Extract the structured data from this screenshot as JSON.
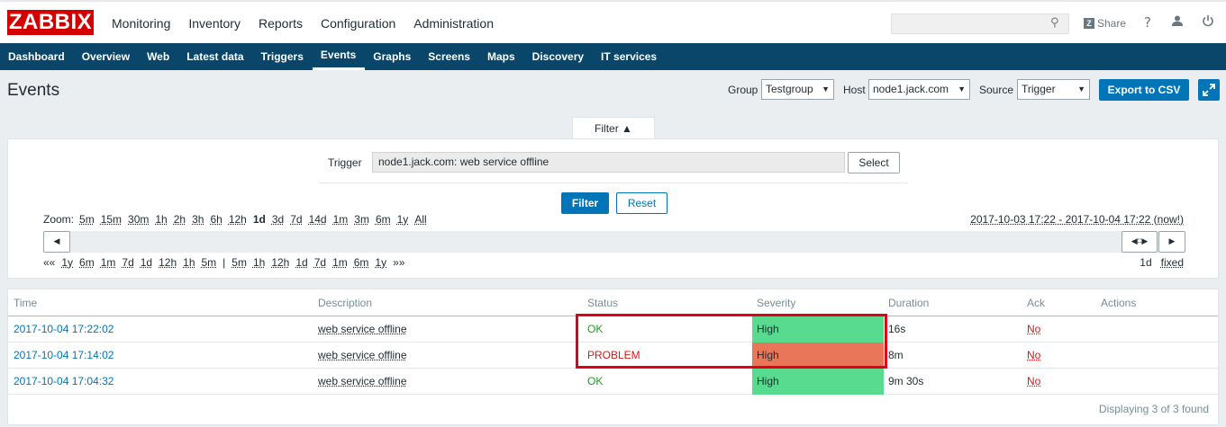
{
  "header": {
    "logo": "ZABBIX",
    "menu": [
      "Monitoring",
      "Inventory",
      "Reports",
      "Configuration",
      "Administration"
    ],
    "search_placeholder": "",
    "share_label": "Share",
    "help_icon": "?"
  },
  "subnav": [
    "Dashboard",
    "Overview",
    "Web",
    "Latest data",
    "Triggers",
    "Events",
    "Graphs",
    "Screens",
    "Maps",
    "Discovery",
    "IT services"
  ],
  "page": {
    "title": "Events",
    "group_label": "Group",
    "group_value": "Testgroup",
    "host_label": "Host",
    "host_value": "node1.jack.com",
    "source_label": "Source",
    "source_value": "Trigger",
    "export_label": "Export to CSV"
  },
  "filter": {
    "tab_label": "Filter ▲",
    "trigger_label": "Trigger",
    "trigger_value": "node1.jack.com: web service offline",
    "select_label": "Select",
    "filter_button": "Filter",
    "reset_button": "Reset",
    "zoom_label": "Zoom:",
    "zoom": [
      "5m",
      "15m",
      "30m",
      "1h",
      "2h",
      "3h",
      "6h",
      "12h",
      "1d",
      "3d",
      "7d",
      "14d",
      "1m",
      "3m",
      "6m",
      "1y",
      "All"
    ],
    "range": "2017-10-03 17:22 - 2017-10-04 17:22 (now!)",
    "nav_back": [
      "««",
      "1y",
      "6m",
      "1m",
      "7d",
      "1d",
      "12h",
      "1h",
      "5m",
      "|",
      "5m",
      "1h",
      "12h",
      "1d",
      "7d",
      "1m",
      "6m",
      "1y",
      "»»"
    ],
    "period": "1d",
    "fixed": "fixed"
  },
  "table": {
    "headers": [
      "Time",
      "Description",
      "Status",
      "Severity",
      "Duration",
      "Ack",
      "Actions"
    ],
    "rows": [
      {
        "time": "2017-10-04 17:22:02",
        "description": "web service offline",
        "status": "OK",
        "severity": "High",
        "duration": "16s",
        "ack": "No"
      },
      {
        "time": "2017-10-04 17:14:02",
        "description": "web service offline",
        "status": "PROBLEM",
        "severity": "High",
        "duration": "8m",
        "ack": "No"
      },
      {
        "time": "2017-10-04 17:04:32",
        "description": "web service offline",
        "status": "OK",
        "severity": "High",
        "duration": "9m 30s",
        "ack": "No"
      }
    ],
    "footer": "Displaying 3 of 3 found"
  },
  "colors": {
    "severity_resolved": "#59db8f",
    "severity_problem": "#e97659",
    "accent": "#0275b8",
    "nav": "#0a466a"
  }
}
